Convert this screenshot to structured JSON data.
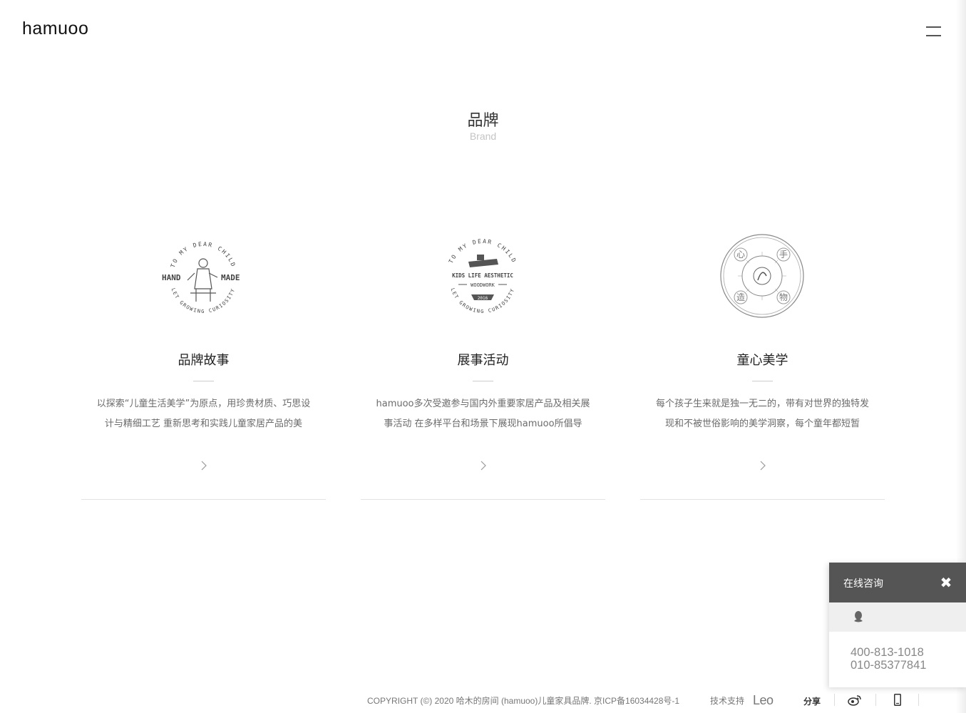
{
  "header": {
    "logo": "hamuoo"
  },
  "section": {
    "title": "品牌",
    "subtitle": "Brand"
  },
  "cards": [
    {
      "icon": "hand-made-stamp-icon",
      "stamp_top": "TO MY DEAR CHILD",
      "stamp_left": "HAND",
      "stamp_right": "MADE",
      "stamp_bottom": "LET GROWING CURIOSITY",
      "title": "品牌故事",
      "desc": "以探索“儿童生活美学”为原点，用珍贵材质、巧思设计与精细工艺 重新思考和实践儿童家居产品的美"
    },
    {
      "icon": "woodwork-stamp-icon",
      "stamp_top": "TO MY DEAR CHILD",
      "stamp_mid": "KIDS LIFE AESTHETIC",
      "stamp_sub": "WOODWORK",
      "stamp_year": "2016",
      "stamp_bottom": "LET GROWING CURIOSITY",
      "title": "展事活动",
      "desc": "hamuoo多次受邀参与国内外重要家居产品及相关展事活动 在多样平台和场景下展现hamuoo所倡导"
    },
    {
      "icon": "handmade-seal-icon",
      "stamp_chars": [
        "心",
        "手",
        "造",
        "物"
      ],
      "title": "童心美学",
      "desc": "每个孩子生来就是独一无二的，带有对世界的独特发现和不被世俗影响的美学洞察，每个童年都短暂"
    }
  ],
  "chat": {
    "title": "在线咨询",
    "phone1": "400-813-1018",
    "phone2": "010-85377841"
  },
  "footer": {
    "copyright": "COPYRIGHT (©) 2020 哈木的房间 (hamuoo)儿童家具品牌.    京ICP备16034428号-1",
    "support_label": "技术支持",
    "support_logo": "Leo",
    "share_label": "分享"
  }
}
